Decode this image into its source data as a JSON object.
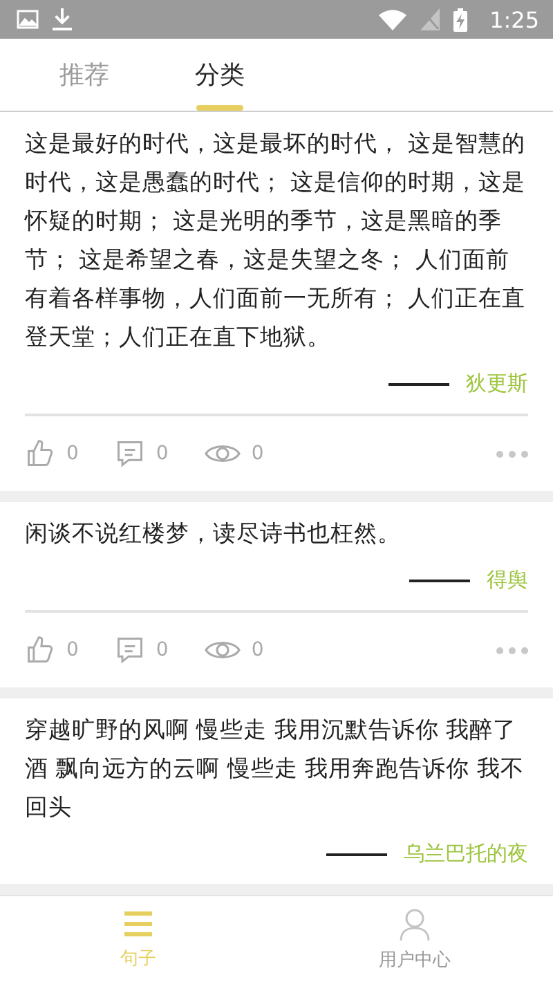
{
  "status_bar": {
    "time": "1:25"
  },
  "tabs": [
    {
      "label": "推荐",
      "selected": false
    },
    {
      "label": "分类",
      "selected": true
    }
  ],
  "posts": [
    {
      "text": "这是最好的时代，这是最坏的时代， 这是智慧的时代，这是愚蠢的时代； 这是信仰的时期，这是怀疑的时期； 这是光明的季节，这是黑暗的季节； 这是希望之春，这是失望之冬； 人们面前有着各样事物，人们面前一无所有； 人们正在直登天堂；人们正在直下地狱。",
      "author": "狄更斯",
      "stats": {
        "likes": "0",
        "comments": "0",
        "views": "0"
      }
    },
    {
      "text": "闲谈不说红楼梦，读尽诗书也枉然。",
      "author": "得舆",
      "stats": {
        "likes": "0",
        "comments": "0",
        "views": "0"
      }
    },
    {
      "text": "穿越旷野的风啊 慢些走 我用沉默告诉你 我醉了酒 飘向远方的云啊 慢些走 我用奔跑告诉你 我不回头",
      "author": "乌兰巴托的夜"
    }
  ],
  "bottom_nav": [
    {
      "label": "句子",
      "selected": true,
      "kind": "list"
    },
    {
      "label": "用户中心",
      "selected": false,
      "kind": "user"
    }
  ]
}
